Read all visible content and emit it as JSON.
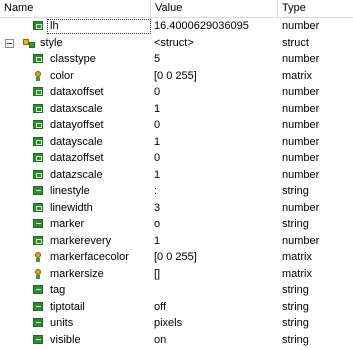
{
  "columns": {
    "name": "Name",
    "value": "Value",
    "type": "Type"
  },
  "rows": [
    {
      "name": "lh",
      "value": "16.4000629036095",
      "type": "number",
      "icon": "number-icon",
      "level": 1,
      "selected": true
    },
    {
      "name": "style",
      "value": "<struct>",
      "type": "struct",
      "icon": "struct-icon",
      "level": 0,
      "expander": true
    },
    {
      "name": "classtype",
      "value": "5",
      "type": "number",
      "icon": "number-icon",
      "level": 2
    },
    {
      "name": "color",
      "value": "[0 0 255]",
      "type": "matrix",
      "icon": "matrix-icon",
      "level": 2
    },
    {
      "name": "dataxoffset",
      "value": "0",
      "type": "number",
      "icon": "number-icon",
      "level": 2
    },
    {
      "name": "dataxscale",
      "value": "1",
      "type": "number",
      "icon": "number-icon",
      "level": 2
    },
    {
      "name": "datayoffset",
      "value": "0",
      "type": "number",
      "icon": "number-icon",
      "level": 2
    },
    {
      "name": "datayscale",
      "value": "1",
      "type": "number",
      "icon": "number-icon",
      "level": 2
    },
    {
      "name": "datazoffset",
      "value": "0",
      "type": "number",
      "icon": "number-icon",
      "level": 2
    },
    {
      "name": "datazscale",
      "value": "1",
      "type": "number",
      "icon": "number-icon",
      "level": 2
    },
    {
      "name": "linestyle",
      "value": ":",
      "type": "string",
      "icon": "string-icon",
      "level": 2
    },
    {
      "name": "linewidth",
      "value": "3",
      "type": "number",
      "icon": "number-icon",
      "level": 2
    },
    {
      "name": "marker",
      "value": "o",
      "type": "string",
      "icon": "string-icon",
      "level": 2
    },
    {
      "name": "markerevery",
      "value": "1",
      "type": "number",
      "icon": "number-icon",
      "level": 2
    },
    {
      "name": "markerfacecolor",
      "value": "[0 0 255]",
      "type": "matrix",
      "icon": "matrix-icon",
      "level": 2
    },
    {
      "name": "markersize",
      "value": "[]",
      "type": "matrix",
      "icon": "matrix-icon",
      "level": 2
    },
    {
      "name": "tag",
      "value": "",
      "type": "string",
      "icon": "string-icon",
      "level": 2
    },
    {
      "name": "tiptotail",
      "value": "off",
      "type": "string",
      "icon": "string-icon",
      "level": 2
    },
    {
      "name": "units",
      "value": "pixels",
      "type": "string",
      "icon": "string-icon",
      "level": 2
    },
    {
      "name": "visible",
      "value": "on",
      "type": "string",
      "icon": "string-icon",
      "level": 2
    }
  ]
}
